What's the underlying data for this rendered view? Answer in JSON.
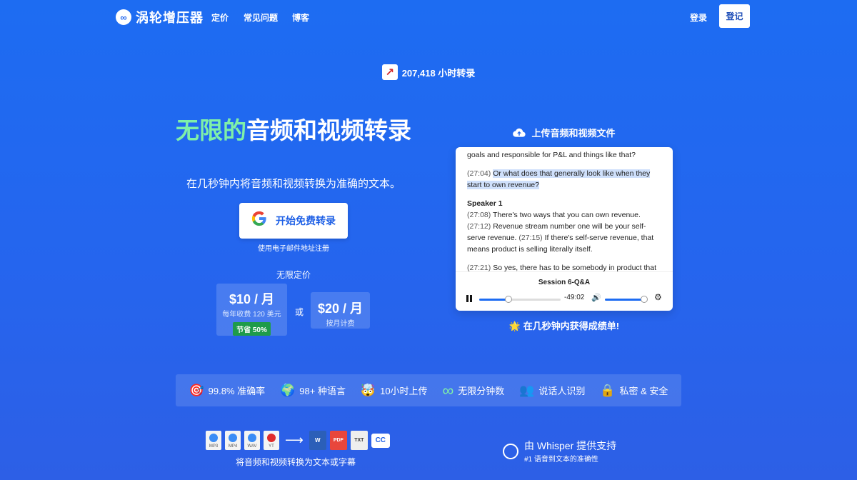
{
  "nav": {
    "logo_text": "涡轮增压器",
    "links": [
      "定价",
      "常见问题",
      "博客"
    ],
    "login": "登录",
    "signup": "登记"
  },
  "stats": {
    "hours_text": "207,418 小时转录"
  },
  "hero": {
    "title_accent": "无限的",
    "title_rest": "音频和视频转录",
    "subtitle": "在几秒钟内将音频和视频转换为准确的文本。",
    "cta_label": "开始免费转录",
    "email_note": "使用电子邮件地址注册"
  },
  "pricing": {
    "label": "无限定价",
    "plan1": {
      "price": "$10 / 月",
      "note": "每年收费 120 美元",
      "badge": "节省 50%"
    },
    "or": "或",
    "plan2": {
      "price": "$20 / 月",
      "note": "按月计费"
    }
  },
  "upload": {
    "heading": "上传音频和视频文件"
  },
  "transcript": {
    "line0": "goals and responsible for P&L and things like that?",
    "q_ts": "(27:04)",
    "q_text": "Or what does that generally look like when they start to own revenue?",
    "speaker": "Speaker 1",
    "a1_ts": "(27:08)",
    "a1_text": "There's two ways that you can own revenue.",
    "a2_ts": "(27:12)",
    "a2_text": "Revenue stream number one will be your self-serve revenue.",
    "a3_ts": "(27:15)",
    "a3_text": "If there's self-serve revenue, that means product is selling literally itself.",
    "a4_ts": "(27:21)",
    "a4_text": "So yes, there has to be somebody in product that"
  },
  "player": {
    "session": "Session 6-Q&A",
    "time": "-49:02",
    "progress": 0.5,
    "volume": 0.95
  },
  "result_text": "在几秒钟内获得成绩单!",
  "features": [
    {
      "icon": "🎯",
      "label": "99.8% 准确率"
    },
    {
      "icon": "🌍",
      "label": "98+ 种语言"
    },
    {
      "icon": "🤯",
      "label": "10小时上传"
    },
    {
      "icon": "∞",
      "label": "无限分钟数"
    },
    {
      "icon": "👥",
      "label": "说话人识别"
    },
    {
      "icon": "🔒",
      "label": "私密 & 安全"
    }
  ],
  "formats": {
    "inputs": [
      "MP3",
      "MP4",
      "WAV",
      "YT"
    ],
    "outputs": [
      "W",
      "PDF",
      "TXT",
      "CC"
    ],
    "label": "将音频和视频转换为文本或字幕"
  },
  "whisper": {
    "title": "由 Whisper 提供支持",
    "subtitle": "#1 语音到文本的准确性"
  }
}
